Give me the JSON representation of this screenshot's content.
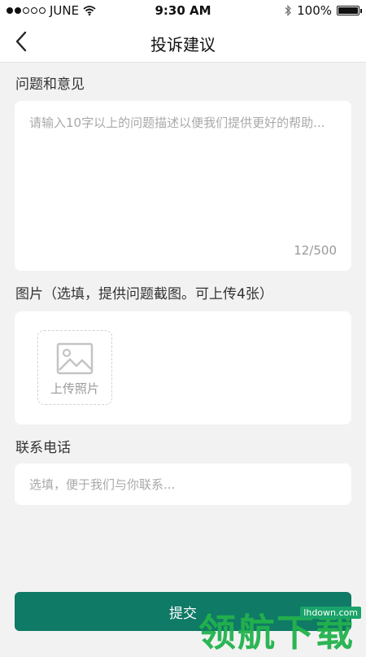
{
  "status_bar": {
    "carrier": "JUNE",
    "time": "9:30 AM",
    "battery": "100%",
    "battery_level": 1.0
  },
  "navbar": {
    "title": "投诉建议",
    "back_icon": "chevron-left-icon"
  },
  "feedback": {
    "label": "问题和意见",
    "placeholder": "请输入10字以上的问题描述以便我们提供更好的帮助...",
    "value": "",
    "counter": "12/500"
  },
  "images": {
    "label": "图片（选填，提供问题截图。可上传4张）",
    "upload_label": "上传照片",
    "upload_icon": "image-icon"
  },
  "contact": {
    "label": "联系电话",
    "placeholder": "选填，便于我们与你联系...",
    "value": ""
  },
  "submit": {
    "label": "提交"
  },
  "watermark": {
    "text": "领航下载",
    "url": "lhdown.com"
  },
  "colors": {
    "accent": "#0f7a66",
    "background": "#f2f2f2",
    "watermark": "#22b24c"
  }
}
